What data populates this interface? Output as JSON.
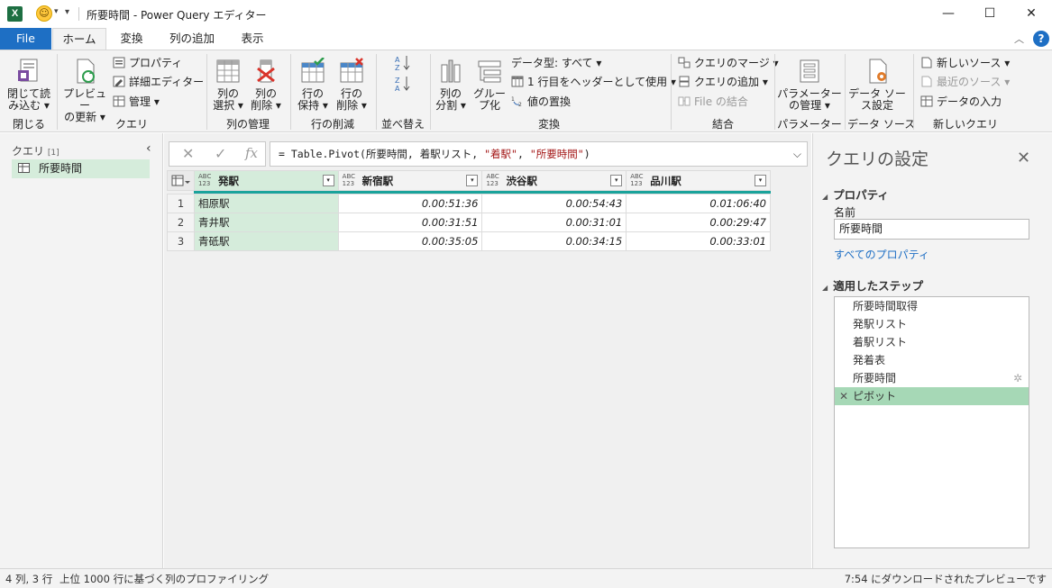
{
  "window": {
    "title": "所要時間 - Power Query エディター",
    "app_icon": "excel-icon"
  },
  "tabs": [
    {
      "label": "File"
    },
    {
      "label": "ホーム"
    },
    {
      "label": "変換"
    },
    {
      "label": "列の追加"
    },
    {
      "label": "表示"
    }
  ],
  "ribbon": {
    "close_load": {
      "line1": "閉じて読",
      "line2": "み込む"
    },
    "close_group": "閉じる",
    "refresh": {
      "line1": "プレビュー",
      "line2": "の更新"
    },
    "properties": "プロパティ",
    "advanced_editor": "詳細エディター",
    "manage": "管理",
    "query_group": "クエリ",
    "choose_cols": {
      "line1": "列の",
      "line2": "選択"
    },
    "remove_cols": {
      "line1": "列の",
      "line2": "削除"
    },
    "manage_cols_group": "列の管理",
    "keep_rows": {
      "line1": "行の",
      "line2": "保持"
    },
    "remove_rows": {
      "line1": "行の",
      "line2": "削除"
    },
    "reduce_rows_group": "行の削減",
    "sort_group": "並べ替え",
    "split_col": {
      "line1": "列の",
      "line2": "分割"
    },
    "group_by": {
      "line1": "グルー",
      "line2": "プ化"
    },
    "data_type": "データ型: すべて",
    "use_header": "1 行目をヘッダーとして使用",
    "replace_values": "値の置換",
    "transform_group": "変換",
    "merge_queries": "クエリのマージ",
    "append_queries": "クエリの追加",
    "combine_files": "File の結合",
    "combine_group": "結合",
    "manage_params": {
      "line1": "パラメーター",
      "line2": "の管理"
    },
    "params_group": "パラメーター",
    "data_source_settings": {
      "line1": "データ ソー",
      "line2": "ス設定"
    },
    "data_source_group": "データ ソース",
    "new_source": "新しいソース",
    "recent_sources": "最近のソース",
    "enter_data": "データの入力",
    "new_query_group": "新しいクエリ"
  },
  "left_pane": {
    "header": "クエリ",
    "count": "[1]",
    "queries": [
      "所要時間"
    ]
  },
  "formula_bar": {
    "prefix": "= Table.Pivot(所要時間, 着駅リスト, ",
    "str1": "\"着駅\"",
    "mid": ", ",
    "str2": "\"所要時間\"",
    "suffix": ")"
  },
  "grid": {
    "columns": [
      "発駅",
      "新宿駅",
      "渋谷駅",
      "品川駅"
    ],
    "type_label": "ABC\n123",
    "rows": [
      {
        "n": "1",
        "cells": [
          "相原駅",
          "0.00:51:36",
          "0.00:54:43",
          "0.01:06:40"
        ]
      },
      {
        "n": "2",
        "cells": [
          "青井駅",
          "0.00:31:51",
          "0.00:31:01",
          "0.00:29:47"
        ]
      },
      {
        "n": "3",
        "cells": [
          "青砥駅",
          "0.00:35:05",
          "0.00:34:15",
          "0.00:33:01"
        ]
      }
    ]
  },
  "right_pane": {
    "title": "クエリの設定",
    "properties_header": "プロパティ",
    "name_label": "名前",
    "name_value": "所要時間",
    "all_properties": "すべてのプロパティ",
    "steps_header": "適用したステップ",
    "steps": [
      "所要時間取得",
      "発駅リスト",
      "着駅リスト",
      "発着表",
      "所要時間",
      "ピボット"
    ]
  },
  "status": {
    "left1": "4 列, 3 行",
    "left2": "上位 1000 行に基づく列のプロファイリング",
    "right": "7:54 にダウンロードされたプレビューです"
  },
  "colors": {
    "accent": "#1e6fc4",
    "selected_col": "#d5ecdb",
    "active_step": "#a6d8b6",
    "quality_bar": "#1aa39b"
  }
}
